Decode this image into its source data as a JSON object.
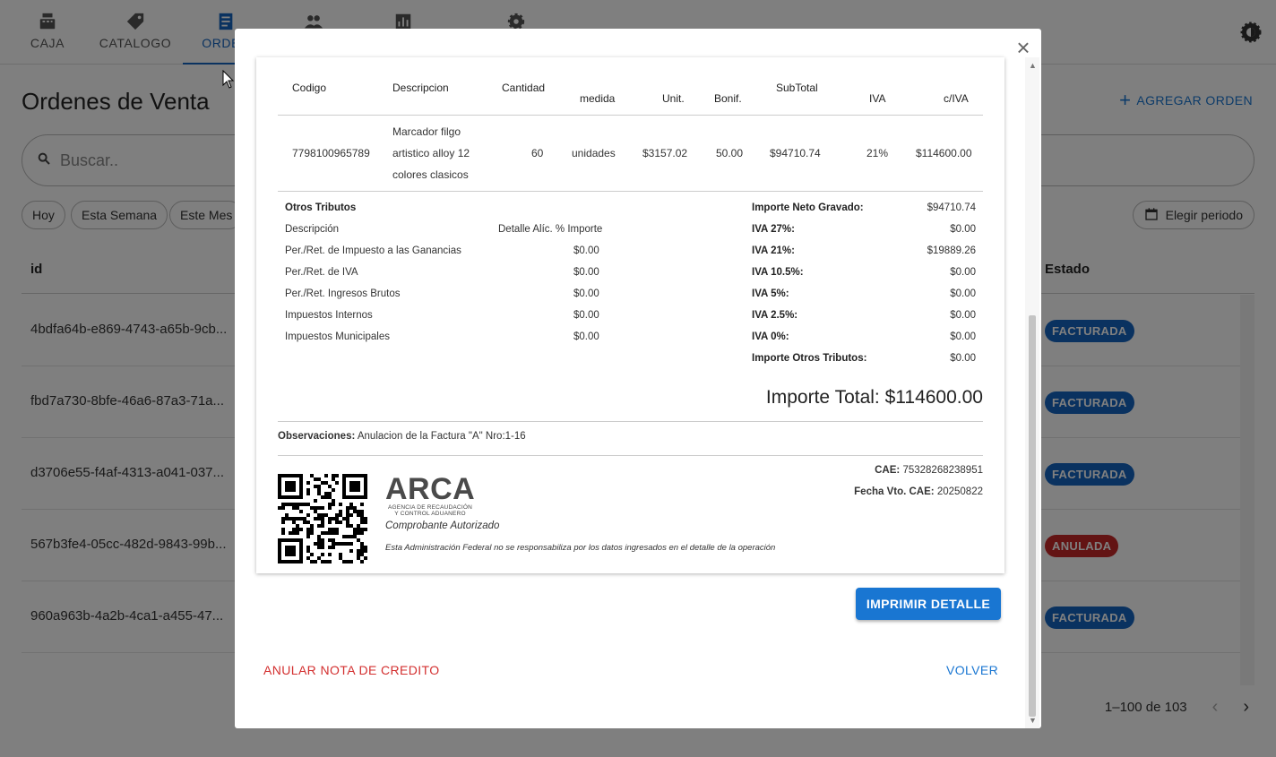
{
  "nav": {
    "tabs": [
      {
        "label": "CAJA",
        "icon": "cash-register-icon"
      },
      {
        "label": "CATALOGO",
        "icon": "tag-icon"
      },
      {
        "label": "ORDEN",
        "icon": "receipt-icon"
      },
      {
        "label": "",
        "icon": "people-icon"
      },
      {
        "label": "",
        "icon": "bar-chart-icon"
      },
      {
        "label": "",
        "icon": "gear-icon"
      }
    ],
    "active_tab": "ORDEN"
  },
  "page": {
    "title": "Ordenes de Venta",
    "add_button": "AGREGAR ORDEN",
    "search_placeholder": "Buscar..",
    "filters": [
      "Hoy",
      "Esta Semana",
      "Este Mes"
    ],
    "period_button": "Elegir periodo",
    "columns": {
      "id": "id",
      "estado": "Estado"
    },
    "rows": [
      {
        "id": "4bdfa64b-e869-4743-a65b-9cb...",
        "estado": "FACTURADA"
      },
      {
        "id": "fbd7a730-8bfe-46a6-87a3-71a...",
        "estado": "FACTURADA"
      },
      {
        "id": "d3706e55-f4af-4313-a041-037...",
        "estado": "FACTURADA"
      },
      {
        "id": "567b3fe4-05cc-482d-9843-99b...",
        "estado": "ANULADA"
      },
      {
        "id": "960a963b-4a2b-4ca1-a455-47...",
        "estado": "FACTURADA"
      }
    ],
    "pagination": "1–100 de 103"
  },
  "colors": {
    "primary": "#1976d2",
    "facturada": "#1565c0",
    "anulada": "#c62828",
    "danger": "#d32f2f"
  },
  "invoice": {
    "headers": {
      "codigo": "Codigo",
      "descripcion": "Descripcion",
      "cantidad": "Cantidad",
      "medida": "medida",
      "unit": "Unit.",
      "bonif": "Bonif.",
      "subtotal": "SubTotal",
      "iva": "IVA",
      "civa": "c/IVA"
    },
    "item": {
      "codigo": "7798100965789",
      "descripcion_1": "Marcador filgo",
      "descripcion_2": "artistico alloy 12",
      "descripcion_3": "colores clasicos",
      "cantidad": "60",
      "medida": "unidades",
      "unit": "$3157.02",
      "bonif": "50.00",
      "subtotal": "$94710.74",
      "iva": "21%",
      "civa": "$114600.00"
    },
    "otros_tributos": {
      "title": "Otros Tributos",
      "header_desc": "Descripción",
      "header_detail": "Detalle Alíc. % Importe",
      "items": [
        {
          "label": "Per./Ret. de Impuesto a las Ganancias",
          "value": "$0.00"
        },
        {
          "label": "Per./Ret. de IVA",
          "value": "$0.00"
        },
        {
          "label": "Per./Ret. Ingresos Brutos",
          "value": "$0.00"
        },
        {
          "label": "Impuestos Internos",
          "value": "$0.00"
        },
        {
          "label": "Impuestos Municipales",
          "value": "$0.00"
        }
      ]
    },
    "totals": [
      {
        "label": "Importe Neto Gravado:",
        "value": "$94710.74"
      },
      {
        "label": "IVA 27%:",
        "value": "$0.00"
      },
      {
        "label": "IVA 21%:",
        "value": "$19889.26"
      },
      {
        "label": "IVA 10.5%:",
        "value": "$0.00"
      },
      {
        "label": "IVA 5%:",
        "value": "$0.00"
      },
      {
        "label": "IVA 2.5%:",
        "value": "$0.00"
      },
      {
        "label": "IVA 0%:",
        "value": "$0.00"
      },
      {
        "label": "Importe Otros Tributos:",
        "value": "$0.00"
      }
    ],
    "importe_total": "Importe Total: $114600.00",
    "observaciones_label": "Observaciones:",
    "observaciones_text": "Anulacion de la Factura \"A\" Nro:1-16",
    "arca": {
      "word": "ARCA",
      "sub_1": "AGENCIA DE RECAUDACIÓN",
      "sub_2": "Y CONTROL ADUANERO",
      "comprobante": "Comprobante Autorizado",
      "disclaimer": "Esta Administración Federal no se responsabiliza por los datos ingresados en el detalle de la operación"
    },
    "cae_label": "CAE:",
    "cae": "75328268238951",
    "fecha_vto_label": "Fecha Vto. CAE:",
    "fecha_vto": "20250822"
  },
  "modal": {
    "print_button": "IMPRIMIR DETALLE",
    "anular_button": "ANULAR NOTA DE CREDITO",
    "volver_button": "VOLVER"
  }
}
